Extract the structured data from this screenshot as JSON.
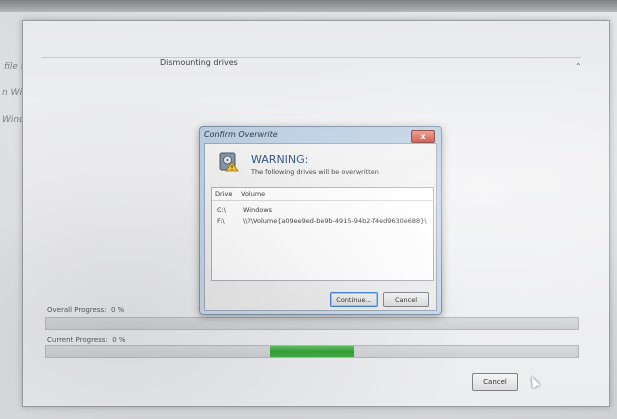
{
  "background": {
    "left_texts": [
      "file to",
      "n Win",
      "Windo"
    ]
  },
  "main_window": {
    "status_text": "Dismounting drives",
    "overall_progress": {
      "label": "Overall Progress:",
      "value": "0 %",
      "fill_fraction": 0
    },
    "current_progress": {
      "label": "Current Progress:",
      "value": "0 %",
      "fill_fraction": 0.2
    },
    "cancel_label": "Cancel"
  },
  "dialog": {
    "title": "Confirm Overwrite",
    "close_symbol": "x",
    "icon": "warning-drive-icon",
    "heading": "WARNING:",
    "subtext": "The following drives will be overwritten",
    "columns": [
      "Drive",
      "Volume"
    ],
    "rows": [
      {
        "drive": "C:\\",
        "volume": "Windows"
      },
      {
        "drive": "F:\\",
        "volume": "\\\\?\\Volume{a09ee9ed-be9b-4915-94b2-f4ed9630e688}\\"
      }
    ],
    "continue_label": "Continue...",
    "cancel_label": "Cancel"
  },
  "colors": {
    "accent": "#1a3f86",
    "progress_green": "#2f9e33",
    "close_red": "#c4392a"
  }
}
